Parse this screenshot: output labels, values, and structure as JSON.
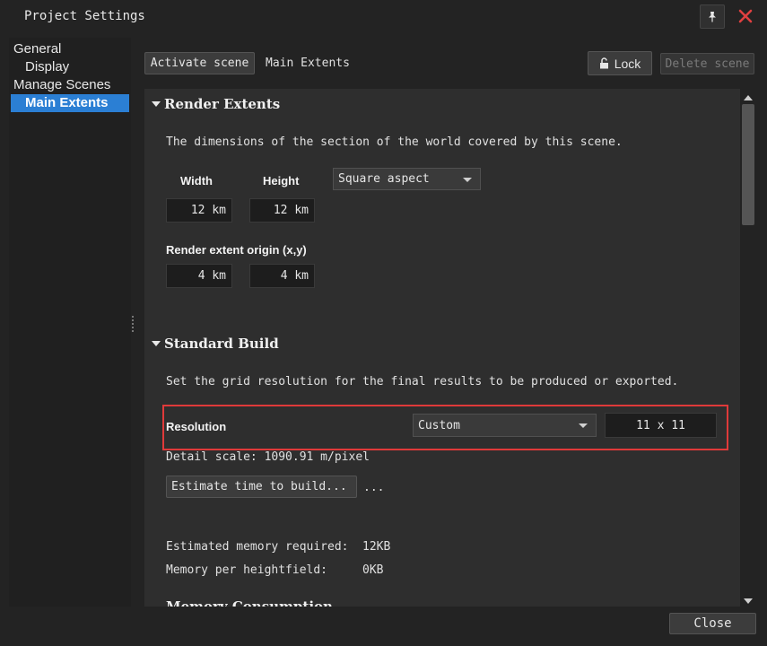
{
  "window": {
    "title": "Project Settings"
  },
  "titlebar": {
    "pin_icon": "pin-icon",
    "close_icon": "close-icon",
    "close_color": "#e04040"
  },
  "sidebar": {
    "items": [
      {
        "label": "General"
      },
      {
        "label": "Display"
      },
      {
        "label": "Manage Scenes"
      },
      {
        "label": "Main Extents",
        "selected": true
      }
    ]
  },
  "toolbar": {
    "activate_label": "Activate scene",
    "scene_name": "Main Extents",
    "lock_label": "Lock",
    "delete_label": "Delete scene"
  },
  "render_extents": {
    "title": "Render Extents",
    "description": "The dimensions of the section of the world covered by this scene.",
    "width_label": "Width",
    "height_label": "Height",
    "aspect_value": "Square aspect",
    "width_value": "12 km",
    "height_value": "12 km",
    "origin_label": "Render extent origin (x,y)",
    "origin_x": "4 km",
    "origin_y": "4 km"
  },
  "standard_build": {
    "title": "Standard Build",
    "description": "Set the grid resolution for the final results to be produced or exported.",
    "resolution_label": "Resolution",
    "resolution_mode": "Custom",
    "resolution_value": "11 x 11",
    "detail_scale": "Detail scale: 1090.91 m/pixel",
    "estimate_label": "Estimate time to build...",
    "estimate_result": "...",
    "memory_required_label": "Estimated memory required:",
    "memory_required_value": "12KB",
    "memory_per_label": "Memory per heightfield:",
    "memory_per_value": "0KB",
    "next_section_partial": "Memory Consumption"
  },
  "footer": {
    "close_label": "Close"
  },
  "colors": {
    "accent": "#2b7fd4",
    "highlight": "#e03a3a",
    "background": "#232323",
    "panel": "#2e2e2e"
  }
}
